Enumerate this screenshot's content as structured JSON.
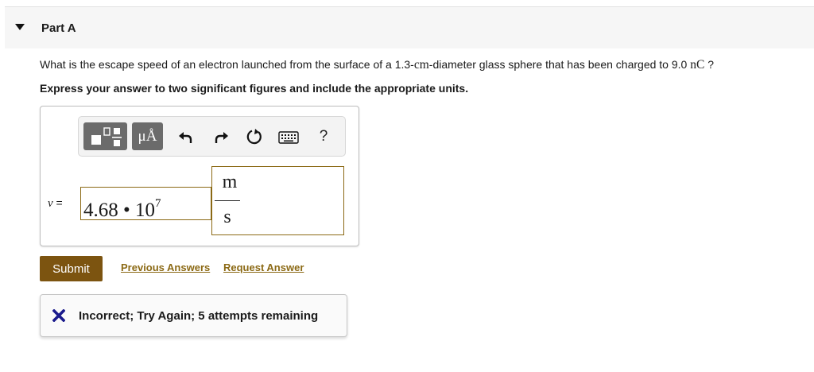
{
  "part": {
    "title": "Part A"
  },
  "question": {
    "text_before": "What is the escape speed of an electron launched from the surface of a 1.3-",
    "unit_cm": "cm",
    "text_middle": "-diameter glass sphere that has been charged to 9.0 ",
    "unit_nc": "nC",
    "text_after": " ?",
    "instructions": "Express your answer to two significant figures and include the appropriate units."
  },
  "toolbar": {
    "unit_button_label": "μÅ",
    "help_button_label": "?",
    "icons": [
      "templates-icon",
      "units-icon",
      "undo-icon",
      "redo-icon",
      "reset-icon",
      "keyboard-icon",
      "help-icon"
    ]
  },
  "answer": {
    "variable": "v",
    "equals": " =",
    "value_mantissa": "4.68 • 10",
    "value_exponent": "7",
    "unit_numerator": "m",
    "unit_denominator": "s"
  },
  "actions": {
    "submit_label": "Submit",
    "previous_answers_label": "Previous Answers",
    "request_answer_label": "Request Answer"
  },
  "feedback": {
    "message": "Incorrect; Try Again; 5 attempts remaining",
    "status_color": "#1a1a8c"
  },
  "colors": {
    "accent": "#7c5410",
    "link": "#8b6914",
    "field_border": "#8b6914"
  }
}
